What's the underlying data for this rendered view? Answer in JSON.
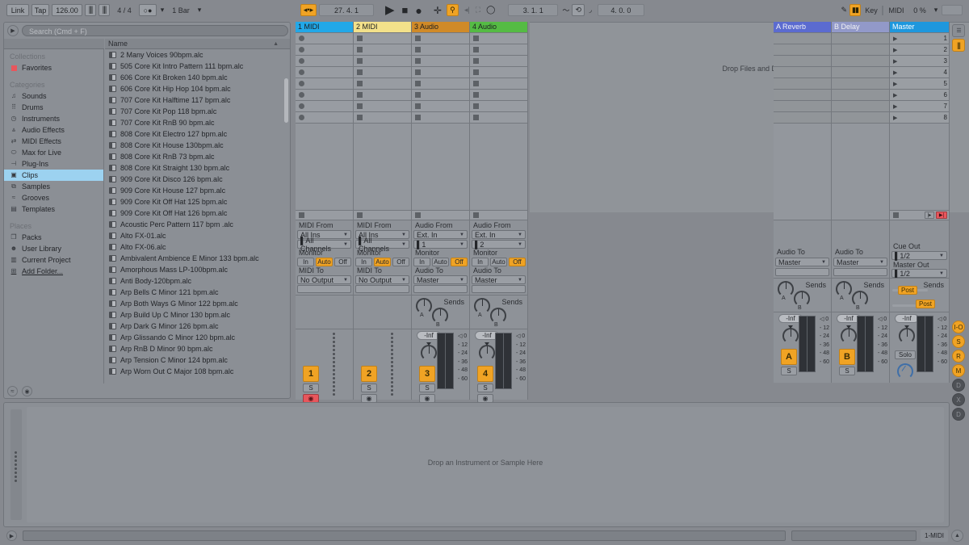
{
  "app": {
    "name": "Ableton Live",
    "accent": "#f0a324",
    "selection_blue": "#2d9fe0"
  },
  "topbar": {
    "link": "Link",
    "tap": "Tap",
    "tempo": "126.00",
    "metro_icon": "metronome-icon",
    "time_signature": "4 / 4",
    "quantize_icon": "record-quantize-icon",
    "launch_quantization": "1 Bar",
    "follow_icon": "follow-icon",
    "position": "27. 4. 1",
    "play_icon": "play-icon",
    "stop_icon": "stop-icon",
    "record_icon": "record-icon",
    "arrangement_record_icon": "plus-icon",
    "automation_icon": "automation-arm-icon",
    "reenable_icon": "re-enable-automation-icon",
    "capture_icon": "capture-midi-icon",
    "loop_toggle_icon": "loop-icon",
    "loop_start": "3. 1. 1",
    "punch_in_icon": "punch-in-icon",
    "loop_switch_icon": "loop-switch-icon",
    "punch_out_icon": "punch-out-icon",
    "loop_length": "4. 0. 0",
    "draw_icon": "draw-mode-icon",
    "session_icon": "session-view-icon",
    "key": "Key",
    "midi": "MIDI",
    "cpu": "0 %"
  },
  "browser": {
    "search_placeholder": "Search (Cmd + F)",
    "name_column": "Name",
    "sort_icon": "sort-ascending-icon",
    "sidebar": {
      "groups": [
        {
          "title": "Collections",
          "items": [
            {
              "label": "Favorites",
              "icon": "favorite-square-icon",
              "selected": false
            }
          ]
        },
        {
          "title": "Categories",
          "items": [
            {
              "label": "Sounds",
              "icon": "sounds-icon",
              "selected": false
            },
            {
              "label": "Drums",
              "icon": "drums-icon",
              "selected": false
            },
            {
              "label": "Instruments",
              "icon": "instruments-icon",
              "selected": false
            },
            {
              "label": "Audio Effects",
              "icon": "audio-effects-icon",
              "selected": false
            },
            {
              "label": "MIDI Effects",
              "icon": "midi-effects-icon",
              "selected": false
            },
            {
              "label": "Max for Live",
              "icon": "max-for-live-icon",
              "selected": false
            },
            {
              "label": "Plug-Ins",
              "icon": "plugins-icon",
              "selected": false
            },
            {
              "label": "Clips",
              "icon": "clips-icon",
              "selected": true
            },
            {
              "label": "Samples",
              "icon": "samples-icon",
              "selected": false
            },
            {
              "label": "Grooves",
              "icon": "grooves-icon",
              "selected": false
            },
            {
              "label": "Templates",
              "icon": "templates-icon",
              "selected": false
            }
          ]
        },
        {
          "title": "Places",
          "items": [
            {
              "label": "Packs",
              "icon": "packs-icon",
              "selected": false
            },
            {
              "label": "User Library",
              "icon": "user-library-icon",
              "selected": false
            },
            {
              "label": "Current Project",
              "icon": "current-project-icon",
              "selected": false
            },
            {
              "label": "Add Folder...",
              "icon": "add-folder-icon",
              "selected": false,
              "link": true
            }
          ]
        }
      ]
    },
    "files": [
      "2 Many Voices 90bpm.alc",
      "505 Core Kit Intro Pattern 111 bpm.alc",
      "606 Core Kit Broken 140 bpm.alc",
      "606 Core Kit Hip Hop 104 bpm.alc",
      "707 Core Kit Halftime 117 bpm.alc",
      "707 Core Kit Pop 118 bpm.alc",
      "707 Core Kit RnB 90 bpm.alc",
      "808 Core Kit Electro 127 bpm.alc",
      "808 Core Kit House 130bpm.alc",
      "808 Core Kit RnB 73 bpm.alc",
      "808 Core Kit Straight 130 bpm.alc",
      "909 Core Kit Disco 126 bpm.alc",
      "909 Core Kit House 127 bpm.alc",
      "909 Core Kit Off Hat 125 bpm.alc",
      "909 Core Kit Off Hat 126 bpm.alc",
      "Acoustic Perc Pattern 117 bpm .alc",
      "Alto FX-01.alc",
      "Alto FX-06.alc",
      "Ambivalent Ambience E Minor 133 bpm.alc",
      "Amorphous Mass LP-100bpm.alc",
      "Anti Body-120bpm.alc",
      "Arp Bells C Minor 121 bpm.alc",
      "Arp Both Ways G Minor 122 bpm.alc",
      "Arp Build Up C Minor 130 bpm.alc",
      "Arp Dark G Minor 126 bpm.alc",
      "Arp Glissando C Minor 120 bpm.alc",
      "Arp RnB D Minor 90 bpm.alc",
      "Arp Tension C Minor 124 bpm.alc",
      "Arp Worn Out C Major 108 bpm.alc"
    ],
    "footer_icon_left": "groove-pool-icon",
    "footer_icon_right": "preview-icon"
  },
  "session": {
    "drop_files_hint": "Drop Files and Devices Here",
    "scene_numbers": [
      "1",
      "2",
      "3",
      "4",
      "5",
      "6",
      "7",
      "8"
    ],
    "scene_play_icon": "scene-launch-icon",
    "tracks": [
      {
        "name": "1 MIDI",
        "color": "#22a8e8",
        "type": "midi",
        "stop_shape": "round",
        "io": {
          "from_label": "MIDI From",
          "from_value": "All Ins",
          "channel_value": "All Channels",
          "monitor_label": "Monitor",
          "monitor": [
            "In",
            "Auto",
            "Off"
          ],
          "monitor_active": "Auto",
          "to_label": "MIDI To",
          "to_value": "No Output",
          "sub_value": ""
        },
        "mixer": {
          "number": "1",
          "solo": "S",
          "arm": "record-arm-icon",
          "armed": true,
          "has_sends": false,
          "volume": "",
          "meter_scale": []
        }
      },
      {
        "name": "2 MIDI",
        "color": "#f3e18a",
        "type": "midi",
        "stop_shape": "square",
        "io": {
          "from_label": "MIDI From",
          "from_value": "All Ins",
          "channel_value": "All Channels",
          "monitor_label": "Monitor",
          "monitor": [
            "In",
            "Auto",
            "Off"
          ],
          "monitor_active": "Auto",
          "to_label": "MIDI To",
          "to_value": "No Output",
          "sub_value": ""
        },
        "mixer": {
          "number": "2",
          "solo": "S",
          "arm": "record-arm-icon",
          "armed": false,
          "has_sends": false,
          "volume": "",
          "meter_scale": []
        }
      },
      {
        "name": "3 Audio",
        "color": "#d08a28",
        "type": "audio",
        "stop_shape": "square",
        "io": {
          "from_label": "Audio From",
          "from_value": "Ext. In",
          "channel_value": "1",
          "monitor_label": "Monitor",
          "monitor": [
            "In",
            "Auto",
            "Off"
          ],
          "monitor_active": "Off",
          "to_label": "Audio To",
          "to_value": "Master",
          "sub_value": ""
        },
        "mixer": {
          "number": "3",
          "solo": "S",
          "arm": "record-arm-icon",
          "armed": false,
          "has_sends": true,
          "volume": "-Inf",
          "meter_scale": [
            "0",
            "12",
            "24",
            "36",
            "48",
            "60"
          ]
        }
      },
      {
        "name": "4 Audio",
        "color": "#55bb44",
        "type": "audio",
        "stop_shape": "square",
        "io": {
          "from_label": "Audio From",
          "from_value": "Ext. In",
          "channel_value": "2",
          "monitor_label": "Monitor",
          "monitor": [
            "In",
            "Auto",
            "Off"
          ],
          "monitor_active": "Off",
          "to_label": "Audio To",
          "to_value": "Master",
          "sub_value": ""
        },
        "mixer": {
          "number": "4",
          "solo": "S",
          "arm": "record-arm-icon",
          "armed": false,
          "has_sends": true,
          "volume": "-Inf",
          "meter_scale": [
            "0",
            "12",
            "24",
            "36",
            "48",
            "60"
          ]
        }
      }
    ],
    "returns": [
      {
        "name": "A Reverb",
        "color": "#5b6bd0",
        "io": {
          "to_label": "Audio To",
          "to_value": "Master"
        },
        "mixer": {
          "letter": "A",
          "solo": "S",
          "volume": "-Inf",
          "meter_scale": [
            "0",
            "12",
            "24",
            "36",
            "48",
            "60"
          ]
        },
        "sends": [
          "A",
          "B"
        ]
      },
      {
        "name": "B Delay",
        "color": "#9299c9",
        "io": {
          "to_label": "Audio To",
          "to_value": "Master"
        },
        "mixer": {
          "letter": "B",
          "solo": "S",
          "volume": "-Inf",
          "meter_scale": [
            "0",
            "12",
            "24",
            "36",
            "48",
            "60"
          ]
        },
        "sends": [
          "A",
          "B"
        ]
      }
    ],
    "master": {
      "name": "Master",
      "color": "#1e97dd",
      "cue_out_label": "Cue Out",
      "cue_out_value": "1/2",
      "master_out_label": "Master Out",
      "master_out_value": "1/2",
      "sends_label": "Sends",
      "pre_post_a": "Post",
      "pre_post_b": "Post",
      "solo_label": "Solo",
      "volume": "-Inf",
      "meter_scale": [
        "0",
        "12",
        "24",
        "36",
        "48",
        "60"
      ],
      "crossfader_icon": "crossfader-icon",
      "preview_icon": "preview-playback-icon",
      "cue_headphone_icon": "headphone-icon"
    },
    "sends_label": "Sends"
  },
  "mixer_strip_icons": {
    "io_button": "in-out-button",
    "sends_button": "sends-button",
    "returns_button": "returns-button",
    "mixer_button": "mixer-button",
    "device_button": "device-button",
    "crossfade_button": "crossfade-button",
    "delay_button": "track-delay-button"
  },
  "detail": {
    "drop_instrument_hint": "Drop an Instrument or Sample Here"
  },
  "statusbar": {
    "play_icon": "status-play-icon",
    "message": "",
    "secondary": "",
    "midi_indicator": "1-MIDI",
    "expand_icon": "expand-detail-icon"
  }
}
